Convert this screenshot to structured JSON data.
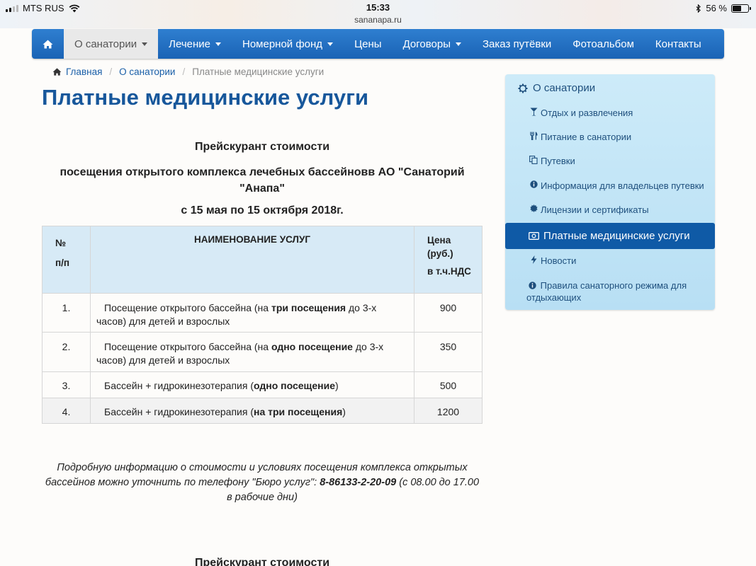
{
  "status_bar": {
    "carrier": "MTS RUS",
    "time": "15:33",
    "url": "sananapa.ru",
    "battery": "56 %",
    "battery_level": 0.56
  },
  "nav": {
    "items": [
      {
        "label": "О санатории",
        "dropdown": true
      },
      {
        "label": "Лечение",
        "dropdown": true
      },
      {
        "label": "Номерной фонд",
        "dropdown": true
      },
      {
        "label": "Цены",
        "dropdown": false
      },
      {
        "label": "Договоры",
        "dropdown": true
      },
      {
        "label": "Заказ путёвки",
        "dropdown": false
      },
      {
        "label": "Фотоальбом",
        "dropdown": false
      },
      {
        "label": "Контакты",
        "dropdown": false
      }
    ]
  },
  "breadcrumb": {
    "home": "Главная",
    "section": "О санатории",
    "current": "Платные медицинские услуги"
  },
  "page": {
    "title": "Платные медицинские услуги",
    "heading1": "Прейскурант стоимости",
    "heading2_line1": "посещения открытого комплекса лечебных бассейновв АО \"Санаторий",
    "heading2_line2": "\"Анапа\"",
    "heading3": "с 15 мая по 15 октября 2018г.",
    "heading_bottom": "Прейскурант стоимости"
  },
  "table": {
    "col_num_line1": "№",
    "col_num_line2": "п/п",
    "col_name": "НАИМЕНОВАНИЕ УСЛУГ",
    "col_price_line1": "Цена",
    "col_price_line2": "(руб.)",
    "col_price_line3": "в т.ч.НДС",
    "rows": [
      {
        "num": "1.",
        "pre": "Посещение открытого бассейна (на ",
        "bold": "три посещения",
        "post": " до 3-х часов) для детей и взрослых",
        "price": "900"
      },
      {
        "num": "2.",
        "pre": "Посещение открытого бассейна (на ",
        "bold": "одно посещение",
        "post": " до 3-х часов) для детей и взрослых",
        "price": "350"
      },
      {
        "num": "3.",
        "pre": "Бассейн + гидрокинезотерапия (",
        "bold": "одно посещение",
        "post": ")",
        "price": "500"
      },
      {
        "num": "4.",
        "pre": "Бассейн + гидрокинезотерапия (",
        "bold": "на три посещения",
        "post": ")",
        "price": "1200"
      }
    ]
  },
  "info": {
    "pre": "Подробную информацию о стоимости и условиях посещения комплекса открытых бассейнов можно уточнить по телефону \"Бюро услуг\": ",
    "phone": "8-86133-2-20-09",
    "post": " (с 08.00 до 17.00 в рабочие дни)"
  },
  "sidebar": {
    "title": "О санатории",
    "items": [
      {
        "label": "Отдых и развлечения",
        "icon": "cocktail-icon"
      },
      {
        "label": "Питание в санатории",
        "icon": "cutlery-icon"
      },
      {
        "label": "Путевки",
        "icon": "copy-icon"
      },
      {
        "label": "Информация для владельцев путевки",
        "icon": "info-icon"
      },
      {
        "label": "Лицензии и сертификаты",
        "icon": "certificate-icon"
      },
      {
        "label": "Платные медицинские услуги",
        "icon": "money-icon",
        "active": true
      },
      {
        "label": "Новости",
        "icon": "flash-icon"
      },
      {
        "label": "Правила санаторного режима для отдыхающих",
        "icon": "info-icon"
      }
    ]
  },
  "colors": {
    "navbar": "#1f6bbf",
    "title": "#17579b",
    "sidebar_bg": "#c6e6f7",
    "sidebar_active": "#0f5aa6",
    "table_header": "#d7eaf6"
  }
}
